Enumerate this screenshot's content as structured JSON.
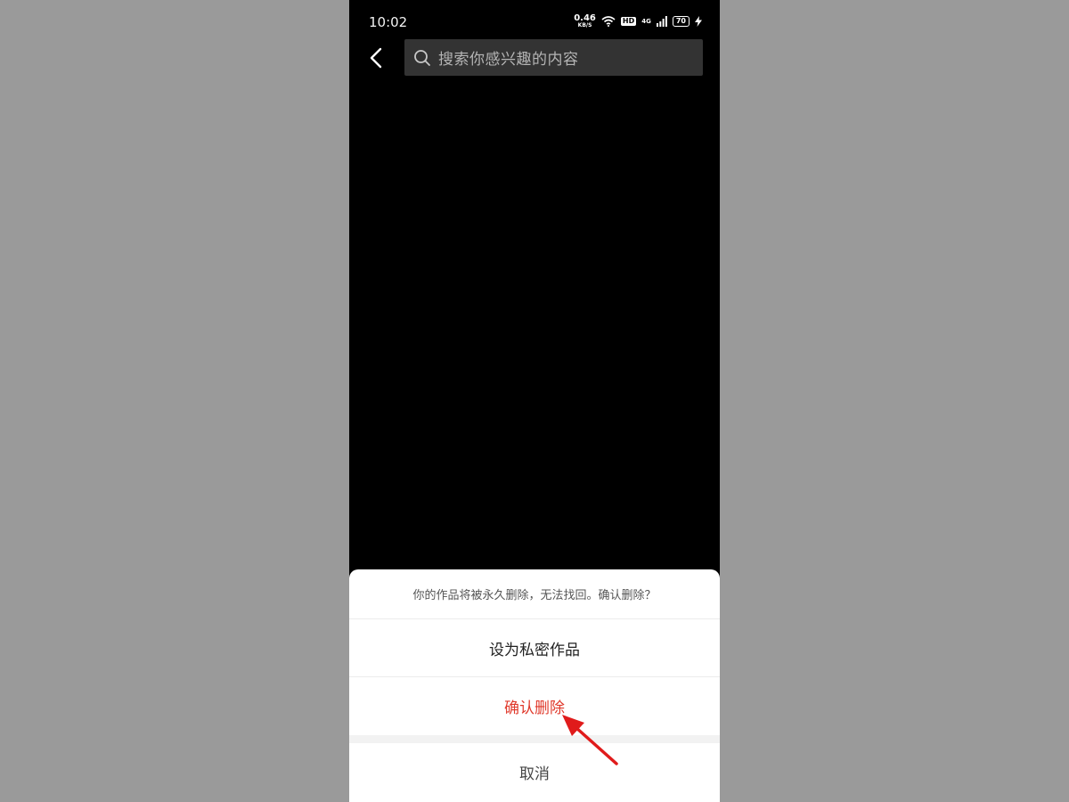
{
  "status_bar": {
    "time": "10:02",
    "net_speed_value": "0.46",
    "net_speed_unit": "KB/S",
    "hd_label": "HD",
    "signal_label": "4G",
    "battery_level": "70",
    "icons": [
      "wifi-icon",
      "signal-icon",
      "charging-icon"
    ]
  },
  "nav": {
    "back_icon": "chevron-left-icon",
    "search_placeholder": "搜索你感兴趣的内容",
    "search_icon": "search-icon"
  },
  "sheet": {
    "message": "你的作品将被永久删除，无法找回。确认删除？",
    "option_private": "设为私密作品",
    "option_delete": "确认删除",
    "cancel": "取消"
  },
  "colors": {
    "danger": "#e03a2c",
    "annotation_arrow": "#e01b1b",
    "backdrop": "#9a9a9a",
    "search_bg": "#333333"
  }
}
